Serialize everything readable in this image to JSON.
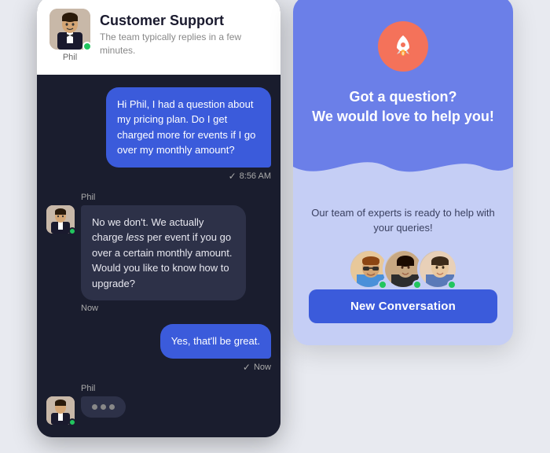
{
  "chat": {
    "header": {
      "title": "Customer Support",
      "subtitle": "The team typically replies in a few minutes.",
      "agent_name": "Phil"
    },
    "messages": [
      {
        "type": "user",
        "text": "Hi Phil, I had a question about my pricing plan. Do I get charged more for events if I go over my monthly amount?",
        "time": "8:56 AM"
      },
      {
        "type": "agent",
        "sender": "Phil",
        "text": "No we don't. We actually charge less per event if you go over a certain monthly amount. Would you like to know how to upgrade?",
        "time": "Now"
      },
      {
        "type": "user",
        "text": "Yes, that'll be great.",
        "time": "Now"
      }
    ]
  },
  "right_panel": {
    "heading_line1": "Got a question?",
    "heading_line2": "We would love to help you!",
    "subtext": "Our team of experts is ready to help with your queries!",
    "new_conversation_label": "New Conversation"
  }
}
